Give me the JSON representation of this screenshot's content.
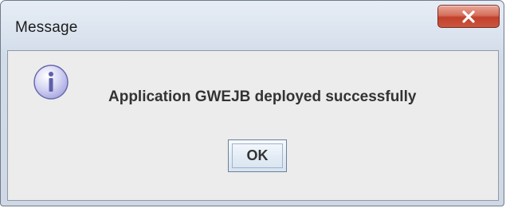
{
  "window": {
    "title": "Message"
  },
  "dialog": {
    "icon": "info-icon",
    "message": "Application GWEJB deployed successfully",
    "ok_label": "OK"
  },
  "colors": {
    "close_button": "#c9573f",
    "icon_fill": "#c9c9f0",
    "client_background": "#ececec"
  }
}
